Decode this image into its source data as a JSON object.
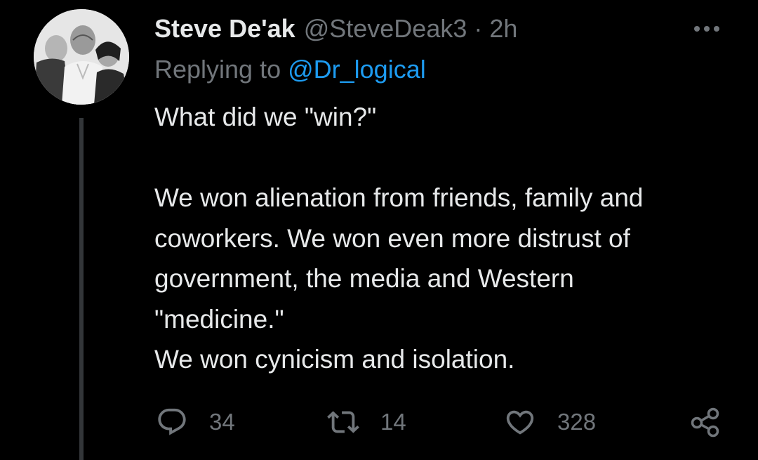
{
  "author": {
    "display_name": "Steve De'ak",
    "handle": "@SteveDeak3",
    "separator": "·",
    "timestamp": "2h",
    "avatar_icon": "profile-photo"
  },
  "reply": {
    "prefix": "Replying to ",
    "target": "@Dr_logical"
  },
  "tweet": {
    "lines": [
      "What did we \"win?\"",
      "",
      "We won alienation from friends, family and",
      "coworkers.  We won even more distrust of",
      "government, the media and Western",
      "\"medicine.\"",
      "We won cynicism and isolation."
    ]
  },
  "actions": {
    "reply": {
      "icon": "reply-icon",
      "count": "34"
    },
    "retweet": {
      "icon": "retweet-icon",
      "count": "14"
    },
    "like": {
      "icon": "heart-icon",
      "count": "328"
    },
    "share": {
      "icon": "share-icon"
    },
    "more": {
      "icon": "more-icon"
    }
  },
  "colors": {
    "background": "#000000",
    "primary_text": "#e7e9ea",
    "secondary_text": "#71767b",
    "link": "#1d9bf0",
    "thread_line": "#333639"
  }
}
